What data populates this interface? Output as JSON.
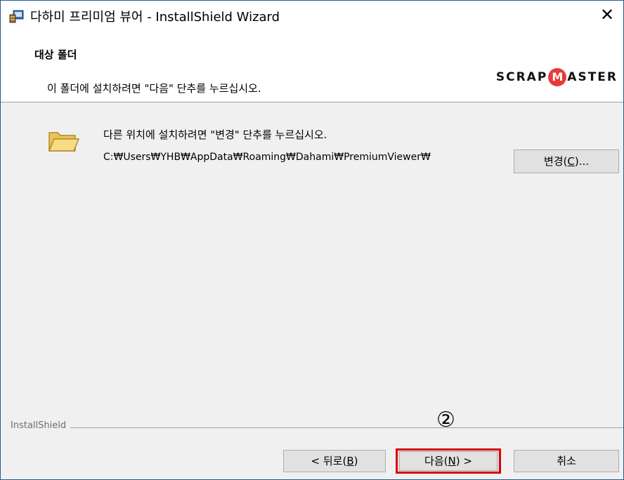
{
  "window": {
    "title": "다하미 프리미엄 뷰어 - InstallShield Wizard",
    "close_glyph": "✕",
    "border_color": "#2b5797"
  },
  "header": {
    "title": "대상 폴더",
    "description": "이 폴더에 설치하려면 \"다음\" 단추를 누르십시오.",
    "brand_prefix": "SCRAP",
    "brand_m": "M",
    "brand_suffix": "ASTER",
    "brand_accent": "#e83a3a"
  },
  "content": {
    "info": "다른 위치에 설치하려면 \"변경\" 단추를 누르십시오.",
    "path": "C:₩Users₩YHB₩AppData₩Roaming₩Dahami₩PremiumViewer₩",
    "change_button": {
      "label_pre": "변경(",
      "label_key": "C",
      "label_post": ")..."
    }
  },
  "footer": {
    "installshield_label": "InstallShield",
    "annotation": "②",
    "back_button": {
      "label_pre": "< 뒤로(",
      "label_key": "B",
      "label_post": ")"
    },
    "next_button": {
      "label_pre": "다음(",
      "label_key": "N",
      "label_post": ") >",
      "highlight_color": "#e00000"
    },
    "cancel_button": {
      "label": "취소"
    }
  },
  "icons": {
    "app": "installer-icon",
    "folder": "folder-icon",
    "close": "close-icon"
  }
}
